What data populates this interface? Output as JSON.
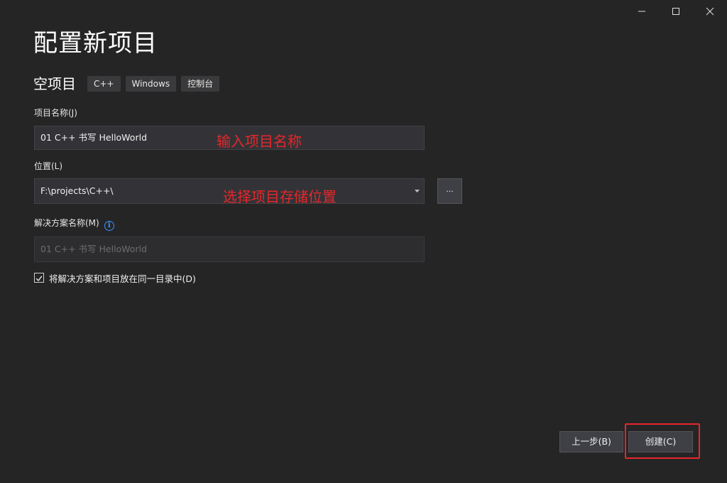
{
  "window": {
    "controls": {
      "minimize_icon": "minimize-icon",
      "maximize_icon": "maximize-icon",
      "close_icon": "close-icon"
    }
  },
  "page": {
    "title": "配置新项目"
  },
  "template": {
    "name": "空项目",
    "tags": [
      "C++",
      "Windows",
      "控制台"
    ]
  },
  "fields": {
    "project_name": {
      "label": "项目名称(J)",
      "value": "01 C++ 书写 HelloWorld"
    },
    "location": {
      "label": "位置(L)",
      "value": "F:\\projects\\C++\\",
      "browse_label": "..."
    },
    "solution_name": {
      "label": "解决方案名称(M)",
      "info_icon": "info-icon",
      "value": "01 C++ 书写 HelloWorld"
    },
    "same_directory": {
      "label": "将解决方案和项目放在同一目录中(D)",
      "checked": true
    }
  },
  "annotations": {
    "project_name_hint": "输入项目名称",
    "location_hint": "选择项目存储位置"
  },
  "buttons": {
    "back_label": "上一步(B)",
    "create_label": "创建(C)"
  },
  "colors": {
    "background": "#252526",
    "annotation": "#e8262a",
    "info_accent": "#3794ff"
  }
}
